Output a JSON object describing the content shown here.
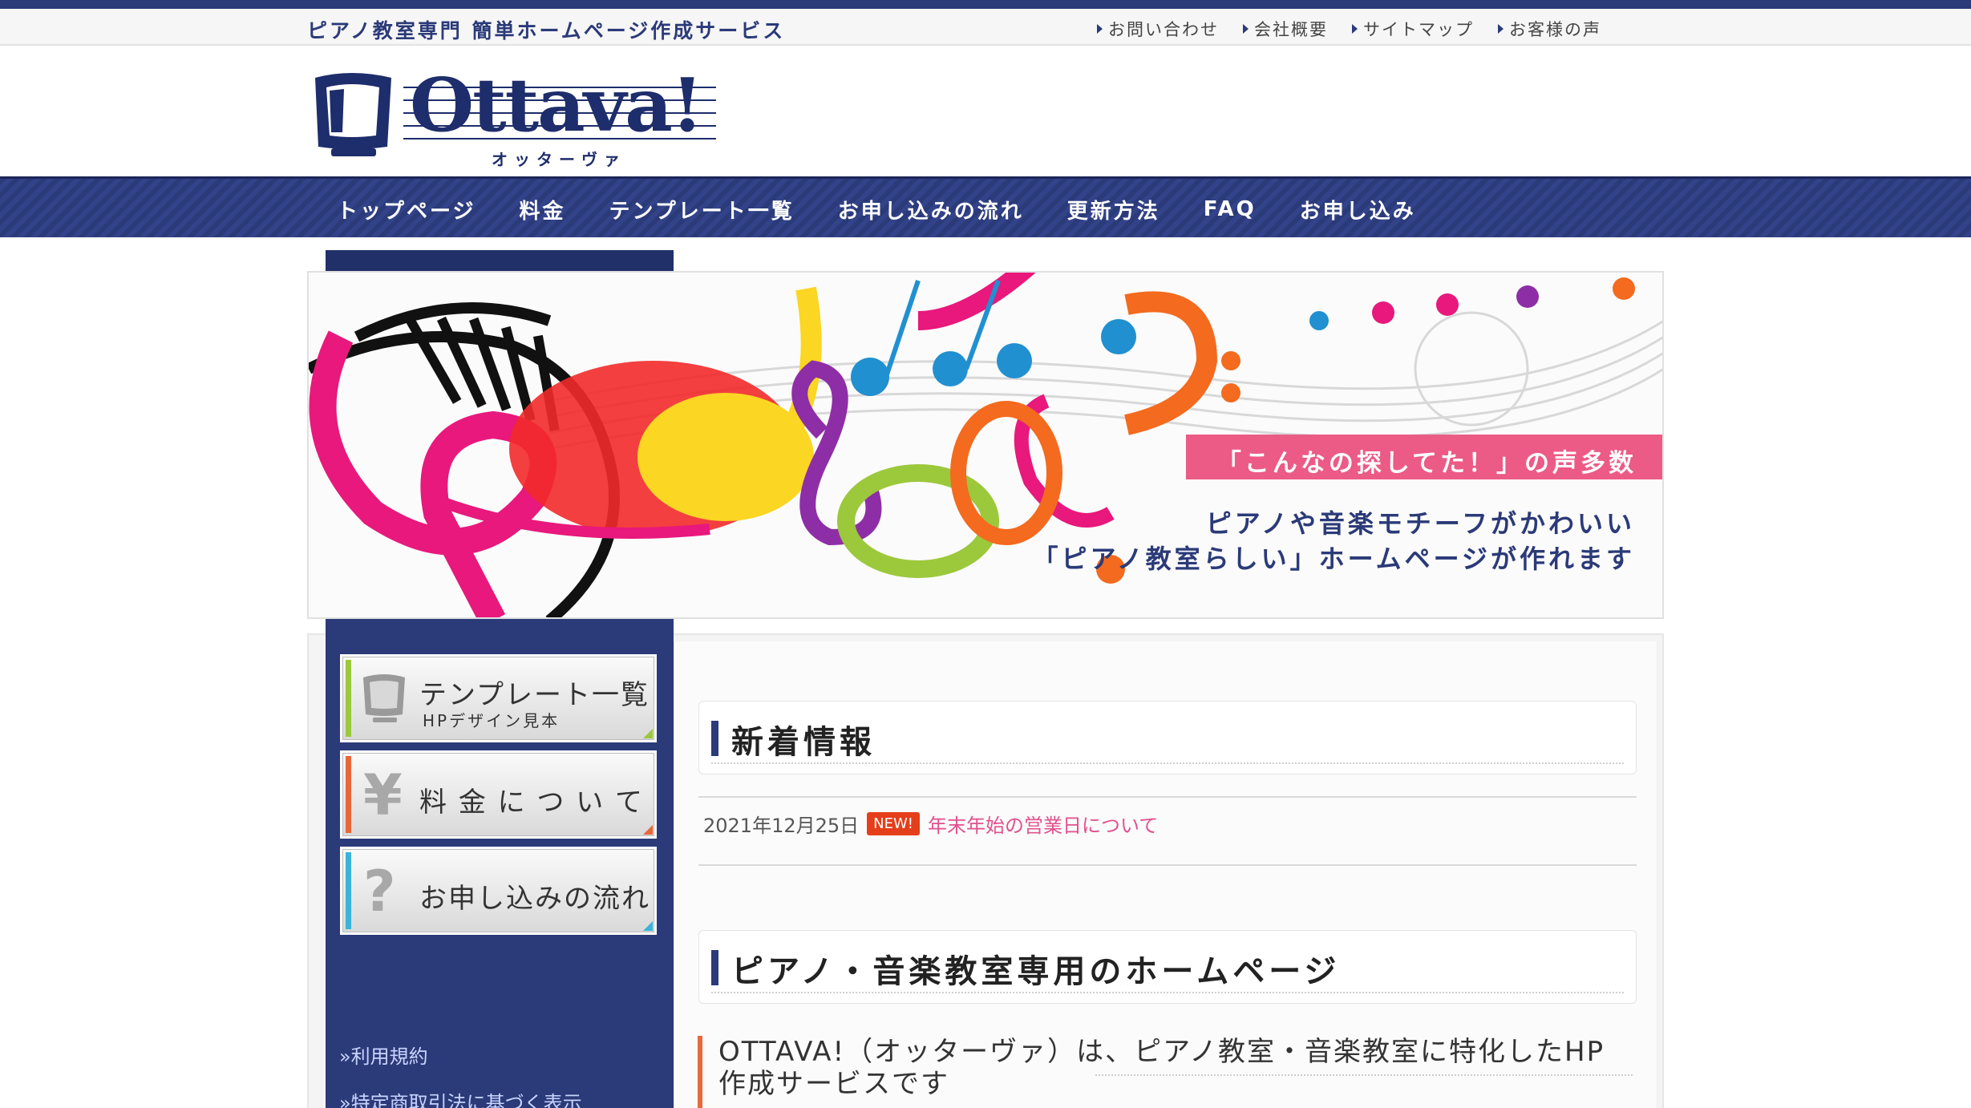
{
  "topbar": {
    "tagline": "ピアノ教室専門 簡単ホームページ作成サービス",
    "links": [
      "お問い合わせ",
      "会社概要",
      "サイトマップ",
      "お客様の声"
    ]
  },
  "logo": {
    "word": "Ottava!",
    "kana": "オッターヴァ"
  },
  "nav": {
    "items": [
      "トップページ",
      "料金",
      "テンプレート一覧",
      "お申し込みの流れ",
      "更新方法",
      "FAQ",
      "お申し込み"
    ]
  },
  "banner": {
    "pink_text": "「こんなの探してた！」の声多数",
    "line1": "ピアノや音楽モチーフがかわいい",
    "line2": "「ピアノ教室らしい」ホームページが作れます"
  },
  "sidebar": {
    "buttons": [
      {
        "label": "テンプレート一覧",
        "sub": "HPデザイン見本",
        "glyph": "monitor-icon",
        "accent": "#9cc83c"
      },
      {
        "label": "料 金 に つ い て",
        "sub": "",
        "glyph": "¥",
        "accent": "#e8663a"
      },
      {
        "label": "お申し込みの流れ",
        "sub": "",
        "glyph": "?",
        "accent": "#3ab4d8"
      }
    ],
    "links": [
      "»利用規約",
      "»特定商取引法に基づく表示"
    ]
  },
  "news": {
    "heading": "新着情報",
    "date": "2021年12月25日",
    "badge": "NEW!",
    "title": "年末年始の営業日について"
  },
  "section": {
    "heading": "ピアノ・音楽教室専用のホームページ",
    "intro": "OTTAVA!（オッターヴァ）は、ピアノ教室・音楽教室に特化したHP作成サービスです"
  },
  "colors": {
    "navy": "#2b3a78",
    "pink": "#ec5a86",
    "news_link": "#e2508e",
    "badge": "#e53e1a"
  }
}
